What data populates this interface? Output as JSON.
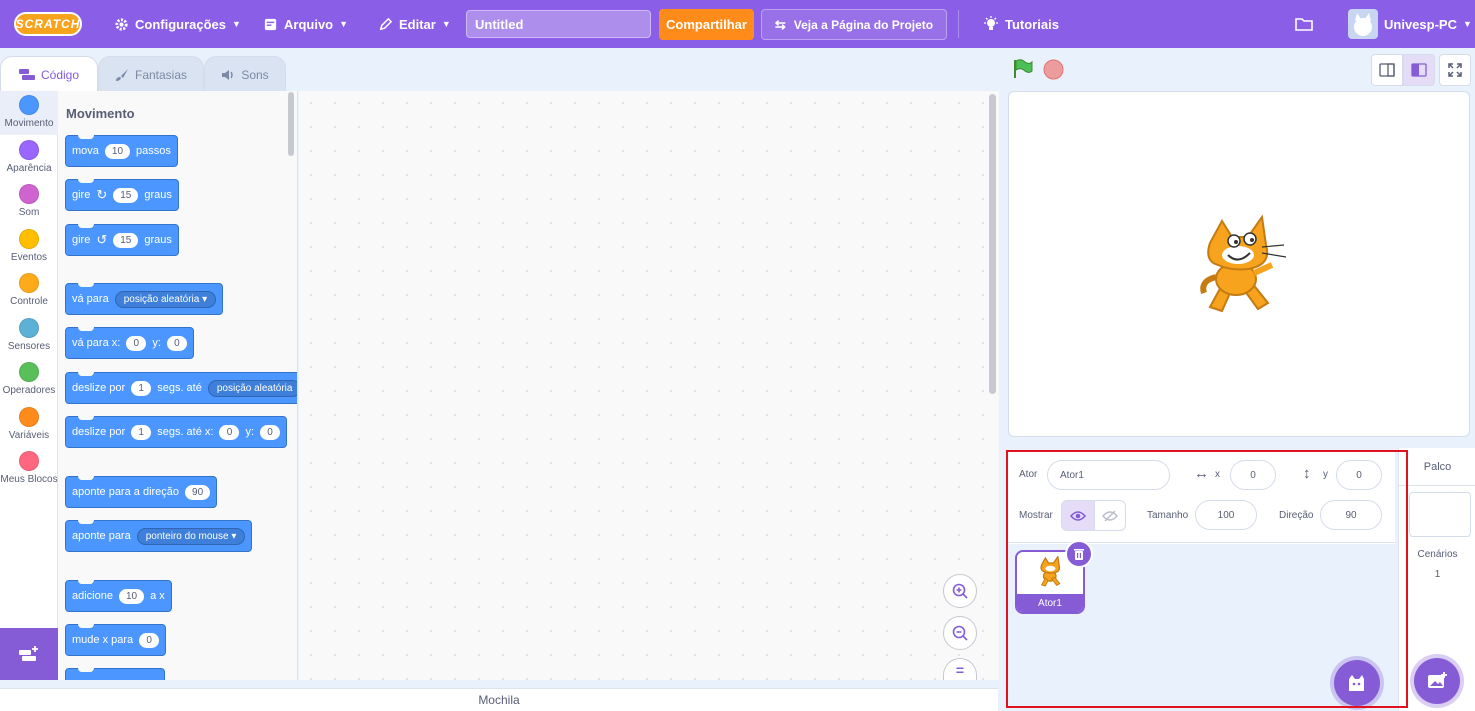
{
  "menubar": {
    "logo": "SCRATCH",
    "settings": "Configurações",
    "file": "Arquivo",
    "edit": "Editar",
    "project_title": "Untitled",
    "share": "Compartilhar",
    "see_project_page": "Veja a Página do Projeto",
    "tutorials": "Tutoriais",
    "username": "Univesp-PC"
  },
  "tabs": [
    {
      "label": "Código"
    },
    {
      "label": "Fantasias"
    },
    {
      "label": "Sons"
    }
  ],
  "categories": [
    {
      "label": "Movimento",
      "color": "#4c97ff"
    },
    {
      "label": "Aparência",
      "color": "#9966ff"
    },
    {
      "label": "Som",
      "color": "#cf63cf"
    },
    {
      "label": "Eventos",
      "color": "#ffbf00"
    },
    {
      "label": "Controle",
      "color": "#ffab19"
    },
    {
      "label": "Sensores",
      "color": "#5cb1d6"
    },
    {
      "label": "Operadores",
      "color": "#59c059"
    },
    {
      "label": "Variáveis",
      "color": "#ff8c1a"
    },
    {
      "label": "Meus Blocos",
      "color": "#ff6680"
    }
  ],
  "palette": {
    "title": "Movimento",
    "b1": {
      "t1": "mova",
      "v1": "10",
      "t2": "passos"
    },
    "b2": {
      "t1": "gire",
      "v1": "15",
      "t2": "graus"
    },
    "b3": {
      "t1": "gire",
      "v1": "15",
      "t2": "graus"
    },
    "b4": {
      "t1": "vá para",
      "d1": "posição aleatória"
    },
    "b5": {
      "t1": "vá para x:",
      "v1": "0",
      "t2": "y:",
      "v2": "0"
    },
    "b6": {
      "t1": "deslize por",
      "v1": "1",
      "t2": "segs. até",
      "d1": "posição aleatória"
    },
    "b7": {
      "t1": "deslize por",
      "v1": "1",
      "t2": "segs. até x:",
      "v2": "0",
      "t3": "y:",
      "v3": "0"
    },
    "b8": {
      "t1": "aponte para a direção",
      "v1": "90"
    },
    "b9": {
      "t1": "aponte para",
      "d1": "ponteiro do mouse"
    },
    "b10": {
      "t1": "adicione",
      "v1": "10",
      "t2": "a x"
    },
    "b11": {
      "t1": "mude x para",
      "v1": "0"
    }
  },
  "backpack": "Mochila",
  "sprite": {
    "label_sprite": "Ator",
    "name": "Ator1",
    "label_x": "x",
    "x": "0",
    "label_y": "y",
    "y": "0",
    "label_show": "Mostrar",
    "label_size": "Tamanho",
    "size": "100",
    "label_direction": "Direção",
    "direction": "90",
    "tile_name": "Ator1"
  },
  "stage_target": {
    "label": "Palco",
    "backdrops_label": "Cenários",
    "backdrops_count": "1"
  },
  "colors": {
    "menubar": "#8a5ee6",
    "accent": "#855cd6",
    "motion": "#4c97ff",
    "share": "#ff8c1a",
    "highlight": "#e0121d"
  }
}
